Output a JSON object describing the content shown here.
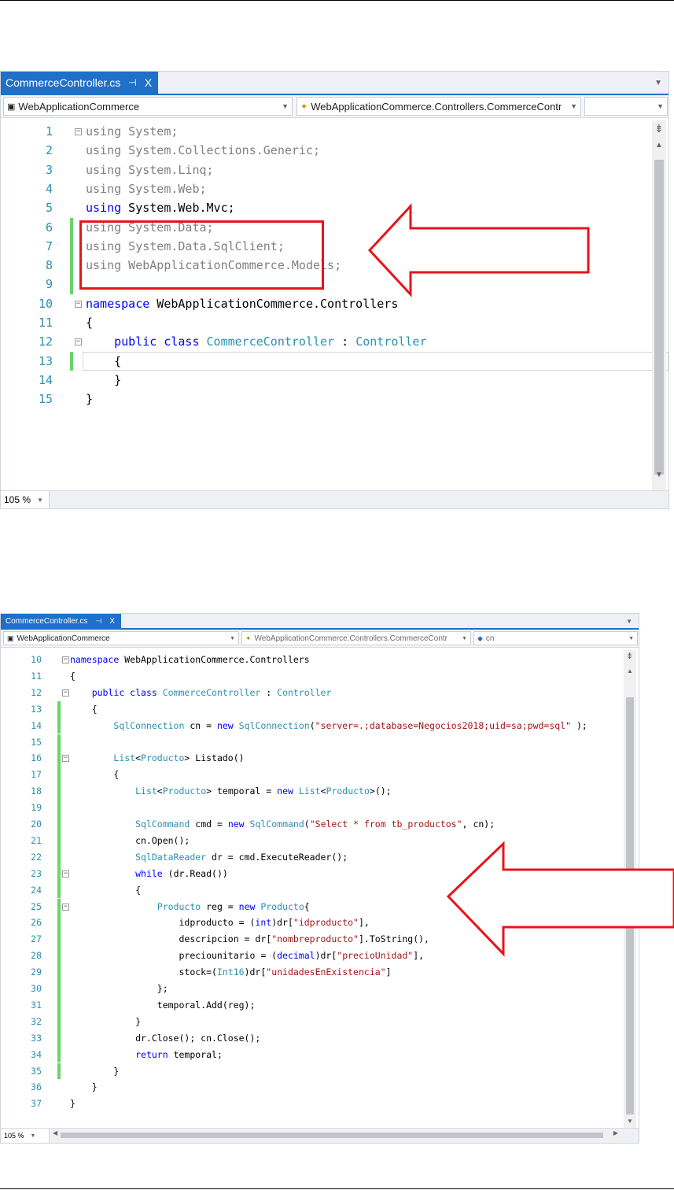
{
  "screenshot1": {
    "tab_title": "CommerceController.cs",
    "tab_pin": "⊣",
    "tab_close": "X",
    "project_combo": "WebApplicationCommerce",
    "class_combo": "WebApplicationCommerce.Controllers.CommerceContr",
    "member_combo": "",
    "zoom": "105 %",
    "lines": [
      {
        "n": "1",
        "html": "<span class='gr'>using System;</span>"
      },
      {
        "n": "2",
        "html": "<span class='gr'>using System.Collections.Generic;</span>"
      },
      {
        "n": "3",
        "html": "<span class='gr'>using System.Linq;</span>"
      },
      {
        "n": "4",
        "html": "<span class='gr'>using System.Web;</span>"
      },
      {
        "n": "5",
        "html": "<span class='kw'>using</span> System.Web.Mvc;"
      },
      {
        "n": "6",
        "html": "<span class='gr'>using System.Data;</span>"
      },
      {
        "n": "7",
        "html": "<span class='gr'>using System.Data.SqlClient;</span>"
      },
      {
        "n": "8",
        "html": "<span class='gr'>using WebApplicationCommerce.Models;</span>"
      },
      {
        "n": "9",
        "html": ""
      },
      {
        "n": "10",
        "html": "<span class='kw'>namespace</span> WebApplicationCommerce.Controllers"
      },
      {
        "n": "11",
        "html": "{"
      },
      {
        "n": "12",
        "html": "    <span class='kw'>public class</span> <span class='ty'>CommerceController</span> : <span class='ty'>Controller</span>"
      },
      {
        "n": "13",
        "html": "    {"
      },
      {
        "n": "14",
        "html": "    }"
      },
      {
        "n": "15",
        "html": "}"
      }
    ]
  },
  "screenshot2": {
    "tab_title": "CommerceController.cs",
    "tab_pin": "⊣",
    "tab_close": "X",
    "project_combo": "WebApplicationCommerce",
    "class_combo": "WebApplicationCommerce.Controllers.CommerceContr",
    "member_combo": "cn",
    "zoom": "105 %",
    "lines": [
      {
        "n": "10",
        "html": "<span class='kw'>namespace</span> WebApplicationCommerce.Controllers"
      },
      {
        "n": "11",
        "html": "{"
      },
      {
        "n": "12",
        "html": "    <span class='kw'>public class</span> <span class='ty'>CommerceController</span> : <span class='ty'>Controller</span>"
      },
      {
        "n": "13",
        "html": "    {"
      },
      {
        "n": "14",
        "html": "        <span class='ty'>SqlConnection</span> cn = <span class='kw'>new</span> <span class='ty'>SqlConnection</span>(<span class='st'>\"server=.;database=Negocios2018;uid=sa;pwd=sql\"</span> );"
      },
      {
        "n": "15",
        "html": ""
      },
      {
        "n": "16",
        "html": "        <span class='ty'>List</span>&lt;<span class='ty'>Producto</span>&gt; Listado()"
      },
      {
        "n": "17",
        "html": "        {"
      },
      {
        "n": "18",
        "html": "            <span class='ty'>List</span>&lt;<span class='ty'>Producto</span>&gt; temporal = <span class='kw'>new</span> <span class='ty'>List</span>&lt;<span class='ty'>Producto</span>&gt;();"
      },
      {
        "n": "19",
        "html": ""
      },
      {
        "n": "20",
        "html": "            <span class='ty'>SqlCommand</span> cmd = <span class='kw'>new</span> <span class='ty'>SqlCommand</span>(<span class='st'>\"Select * from tb_productos\"</span>, cn);"
      },
      {
        "n": "21",
        "html": "            cn.Open();"
      },
      {
        "n": "22",
        "html": "            <span class='ty'>SqlDataReader</span> dr = cmd.ExecuteReader();"
      },
      {
        "n": "23",
        "html": "            <span class='kw'>while</span> (dr.Read())"
      },
      {
        "n": "24",
        "html": "            {"
      },
      {
        "n": "25",
        "html": "                <span class='ty'>Producto</span> reg = <span class='kw'>new</span> <span class='ty'>Producto</span>{"
      },
      {
        "n": "26",
        "html": "                    idproducto = (<span class='kw'>int</span>)dr[<span class='st'>\"idproducto\"</span>],"
      },
      {
        "n": "27",
        "html": "                    descripcion = dr[<span class='st'>\"nombreproducto\"</span>].ToString(),"
      },
      {
        "n": "28",
        "html": "                    preciounitario = (<span class='kw'>decimal</span>)dr[<span class='st'>\"precioUnidad\"</span>],"
      },
      {
        "n": "29",
        "html": "                    stock=(<span class='ty'>Int16</span>)dr[<span class='st'>\"unidadesEnExistencia\"</span>]"
      },
      {
        "n": "30",
        "html": "                };"
      },
      {
        "n": "31",
        "html": "                temporal.Add(reg);"
      },
      {
        "n": "32",
        "html": "            }"
      },
      {
        "n": "33",
        "html": "            dr.Close(); cn.Close();"
      },
      {
        "n": "34",
        "html": "            <span class='kw'>return</span> temporal;"
      },
      {
        "n": "35",
        "html": "        }"
      },
      {
        "n": "36",
        "html": "    }"
      },
      {
        "n": "37",
        "html": "}"
      }
    ]
  },
  "colors": {
    "accent": "#1e70c8",
    "highlight_red": "#e8141b",
    "change_green": "#6bd36b"
  }
}
